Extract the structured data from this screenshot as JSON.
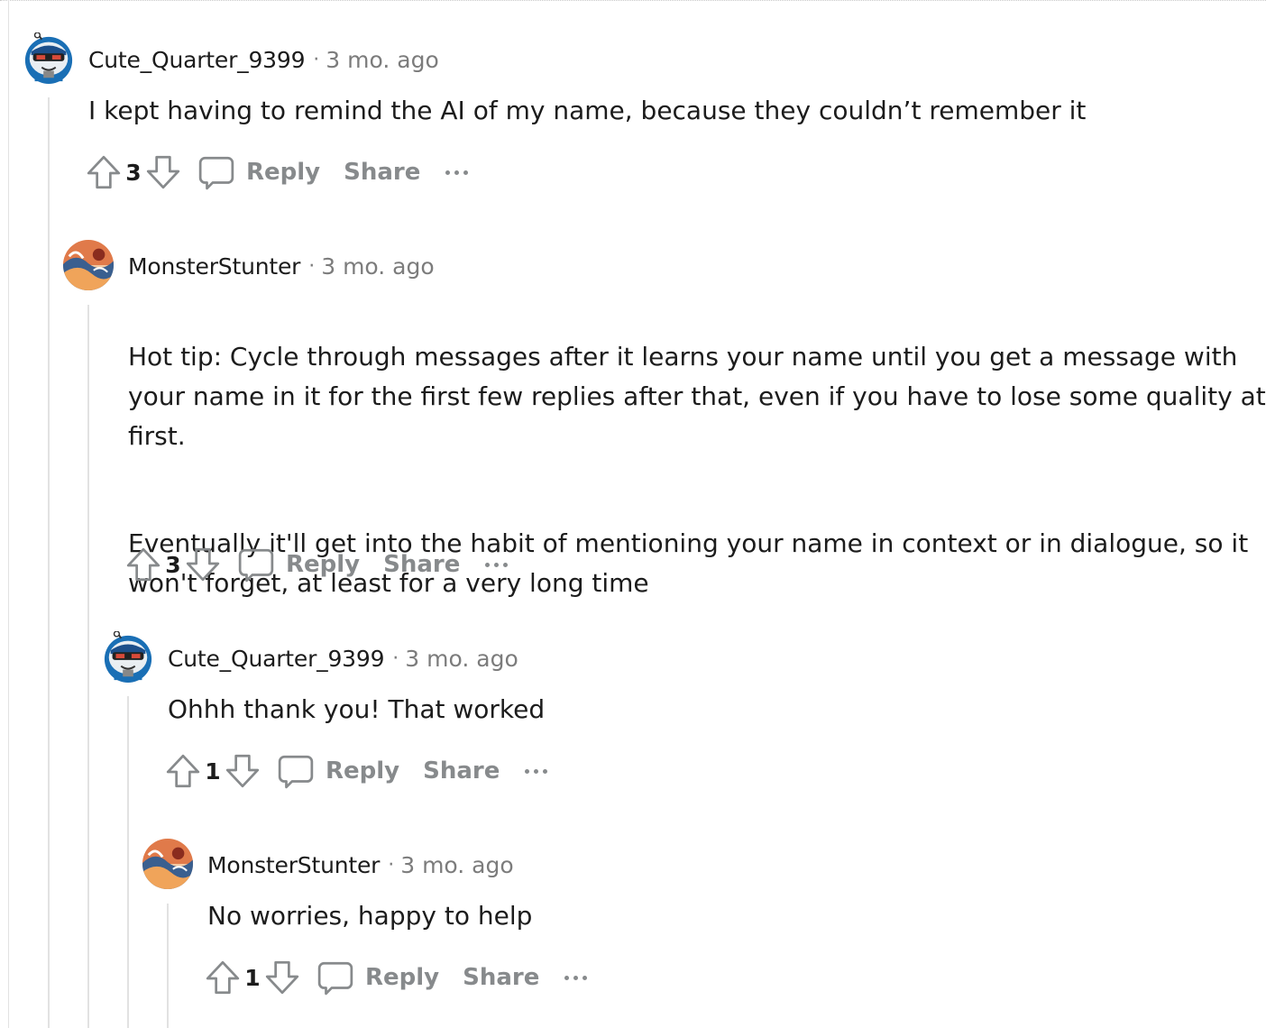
{
  "comments": [
    {
      "username": "Cute_Quarter_9399",
      "separator": "·",
      "time": "3 mo. ago",
      "paragraphs": [
        "I kept having to remind the AI of my name, because they couldn’t remember it"
      ],
      "score": "3",
      "reply_label": "Reply",
      "share_label": "Share",
      "avatar_icon": "snoo-avatar-icon"
    },
    {
      "username": "MonsterStunter",
      "separator": "·",
      "time": "3 mo. ago",
      "paragraphs": [
        "Hot tip: Cycle through messages after it learns your name until you get a message with\nyour name in it for the first few replies after that, even if you have to lose some quality at\nfirst.",
        "Eventually it'll get into the habit of mentioning your name in context or in dialogue, so it\nwon't forget, at least for a very long time"
      ],
      "score": "3",
      "reply_label": "Reply",
      "share_label": "Share",
      "avatar_icon": "wave-art-avatar-icon"
    },
    {
      "username": "Cute_Quarter_9399",
      "separator": "·",
      "time": "3 mo. ago",
      "paragraphs": [
        "Ohhh thank you! That worked"
      ],
      "score": "1",
      "reply_label": "Reply",
      "share_label": "Share",
      "avatar_icon": "snoo-avatar-icon"
    },
    {
      "username": "MonsterStunter",
      "separator": "·",
      "time": "3 mo. ago",
      "paragraphs": [
        "No worries, happy to help"
      ],
      "score": "1",
      "reply_label": "Reply",
      "share_label": "Share",
      "avatar_icon": "wave-art-avatar-icon"
    }
  ],
  "colors": {
    "text": "#1c1c1c",
    "muted": "#7c7c7c",
    "action": "#878a8c",
    "thread_line": "#e2e2e2"
  }
}
